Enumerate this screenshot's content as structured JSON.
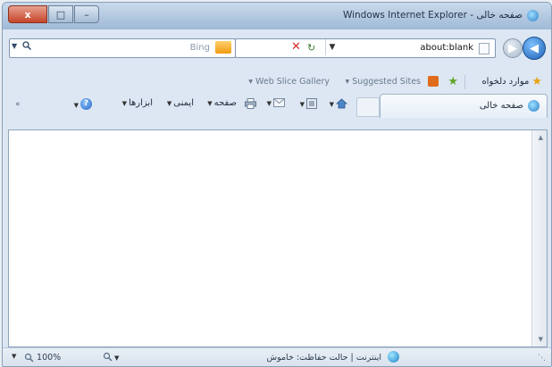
{
  "window": {
    "title_brand": "Windows Internet Explorer",
    "title_sep": " - ",
    "title_page": "صفحه خالی"
  },
  "caption_buttons": {
    "close": "x",
    "max": "□",
    "min": "–"
  },
  "nav": {
    "back_glyph": "◀",
    "forward_glyph": "▶",
    "address": "about:blank",
    "refresh_glyph": "↻",
    "stop_glyph": "✕",
    "dropdown_glyph": "▼"
  },
  "search": {
    "provider": "Bing",
    "icon": "search-icon",
    "dropdown_glyph": "▼"
  },
  "favorites_bar": {
    "favorites_label": "موارد دلخواه",
    "suggested_sites": "Suggested Sites",
    "web_slice_gallery": "Web Slice Gallery"
  },
  "tab": {
    "label": "صفحه خالی"
  },
  "command_bar": {
    "home_arrow": "▼",
    "feeds_arrow": "▼",
    "mail_arrow": "▼",
    "page_label": "صفحه",
    "safety_label": "ایمنی",
    "tools_label": "ابزارها",
    "help_glyph": "?",
    "arrow": "▼",
    "chevron": "»"
  },
  "status_bar": {
    "text": "اینترنت | حالت حفاظت: خاموش",
    "zoom": "100%",
    "zoom_arrow": "▼",
    "protect_arrow": "▼"
  },
  "colors": {
    "accent": "#2a7fc7",
    "close_button": "#c5442a",
    "bing": "#f29b12"
  }
}
